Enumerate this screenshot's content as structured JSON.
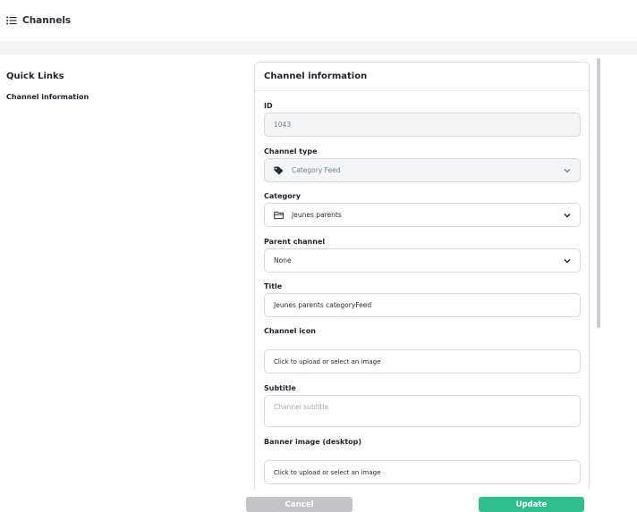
{
  "header": {
    "title": "Channels",
    "icon": "list-icon"
  },
  "quick_links": {
    "heading": "Quick Links",
    "items": [
      "Channel information"
    ]
  },
  "card": {
    "title": "Channel information",
    "fields": {
      "id": {
        "label": "ID",
        "value": "1043"
      },
      "channel_type": {
        "label": "Channel type",
        "value": "Category Feed",
        "icon": "tag-icon"
      },
      "category": {
        "label": "Category",
        "value": "Jeunes parents",
        "icon": "folder-icon"
      },
      "parent_channel": {
        "label": "Parent channel",
        "value": "None"
      },
      "title": {
        "label": "Title",
        "value": "Jeunes parents categoryFeed"
      },
      "channel_icon": {
        "label": "Channel icon",
        "upload_text": "Click to upload or select an image"
      },
      "subtitle": {
        "label": "Subtitle",
        "placeholder": "Channel subtitle"
      },
      "banner_desktop": {
        "label": "Banner image (desktop)",
        "upload_text": "Click to upload or select an image"
      }
    }
  },
  "actions": {
    "cancel": "Cancel",
    "update": "Update"
  },
  "colors": {
    "accent": "#2fbe8c",
    "cancel": "#c2c4c8",
    "band": "#f3f4f6"
  }
}
